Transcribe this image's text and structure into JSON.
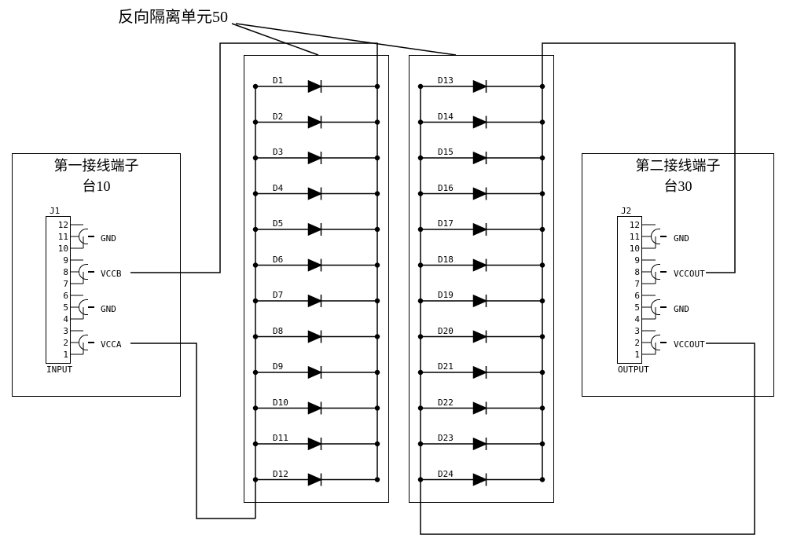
{
  "topLabel": "反向隔离单元50",
  "block1": {
    "line1": "第一接线端子",
    "line2": "台10"
  },
  "block2": {
    "line1": "第二接线端子",
    "line2": "台30"
  },
  "terminal1": {
    "designator": "J1",
    "pins": [
      "12",
      "11",
      "10",
      "9",
      "8",
      "7",
      "6",
      "5",
      "4",
      "3",
      "2",
      "1"
    ],
    "bottom": "INPUT",
    "nets": {
      "gnd1": "GND",
      "vccb": "VCCB",
      "gnd2": "GND",
      "vcca": "VCCA"
    }
  },
  "terminal2": {
    "designator": "J2",
    "pins": [
      "12",
      "11",
      "10",
      "9",
      "8",
      "7",
      "6",
      "5",
      "4",
      "3",
      "2",
      "1"
    ],
    "bottom": "OUTPUT",
    "nets": {
      "gnd1": "GND",
      "vccout1": "VCCOUT",
      "gnd2": "GND",
      "vccout2": "VCCOUT"
    }
  },
  "diodesLeft": [
    "D1",
    "D2",
    "D3",
    "D4",
    "D5",
    "D6",
    "D7",
    "D8",
    "D9",
    "D10",
    "D11",
    "D12"
  ],
  "diodesRight": [
    "D13",
    "D14",
    "D15",
    "D16",
    "D17",
    "D18",
    "D19",
    "D20",
    "D21",
    "D22",
    "D23",
    "D24"
  ]
}
